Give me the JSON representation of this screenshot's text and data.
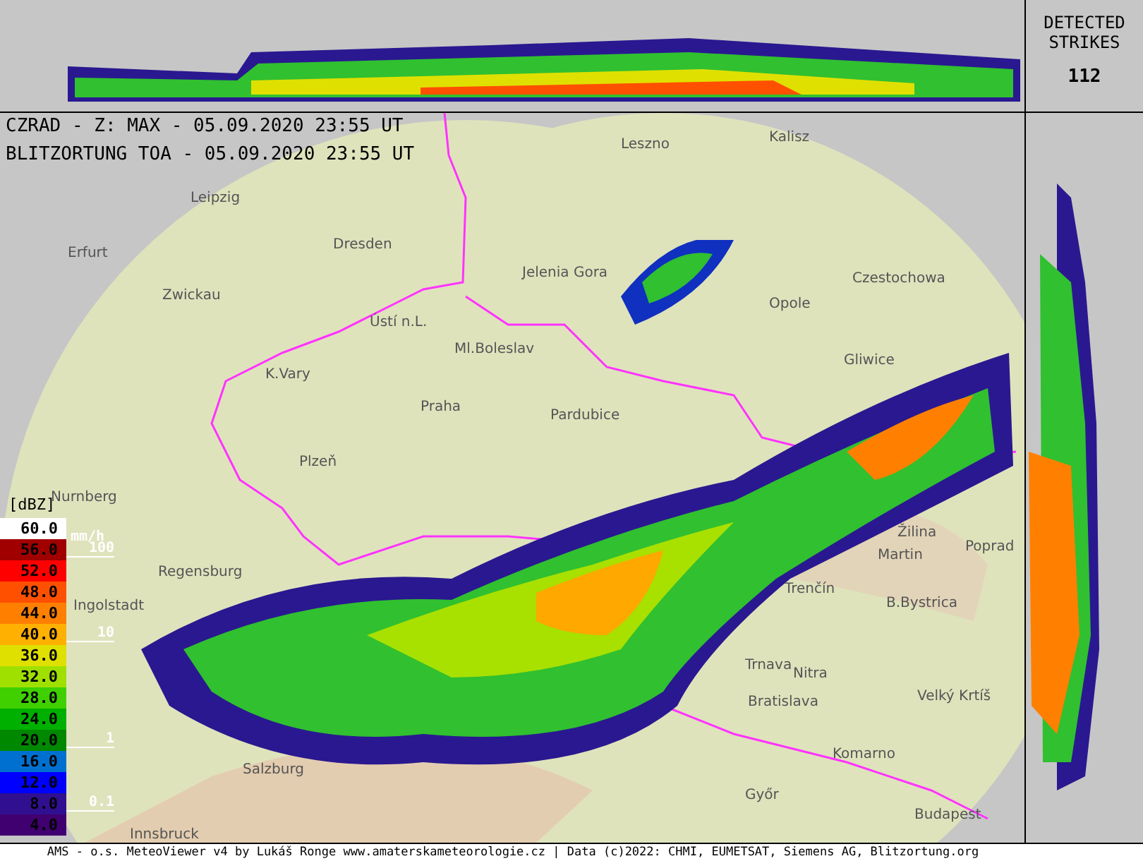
{
  "header": {
    "lines": [
      "CZRAD - Z: MAX - 05.09.2020 23:55 UT",
      "BLITZORTUNG TOA - 05.09.2020 23:55 UT"
    ]
  },
  "strikes": {
    "title_lines": [
      "DETECTED",
      "STRIKES"
    ],
    "count": "112"
  },
  "legend": {
    "unit": "[dBZ]",
    "rows": [
      {
        "label": "60.0",
        "color": "#ffffff"
      },
      {
        "label": "56.0",
        "color": "#a00000"
      },
      {
        "label": "52.0",
        "color": "#ff0000"
      },
      {
        "label": "48.0",
        "color": "#ff5000"
      },
      {
        "label": "44.0",
        "color": "#ff8000"
      },
      {
        "label": "40.0",
        "color": "#ffb000"
      },
      {
        "label": "36.0",
        "color": "#e0e000"
      },
      {
        "label": "32.0",
        "color": "#a0e000"
      },
      {
        "label": "28.0",
        "color": "#40d000"
      },
      {
        "label": "24.0",
        "color": "#00b000"
      },
      {
        "label": "20.0",
        "color": "#008800"
      },
      {
        "label": "16.0",
        "color": "#0070d0"
      },
      {
        "label": "12.0",
        "color": "#0000ff"
      },
      {
        "label": "8.0",
        "color": "#301090"
      },
      {
        "label": "4.0",
        "color": "#400070"
      }
    ],
    "rain_unit": "mm/h",
    "rain_marks": [
      "100",
      "10",
      "1",
      "0.1"
    ]
  },
  "cities": [
    {
      "name": "Leszno"
    },
    {
      "name": "Kalisz"
    },
    {
      "name": "Leipzig"
    },
    {
      "name": "Erfurt"
    },
    {
      "name": "Dresden"
    },
    {
      "name": "Jelenia Gora"
    },
    {
      "name": "Opole"
    },
    {
      "name": "Czestochowa"
    },
    {
      "name": "Zwickau"
    },
    {
      "name": "Ústí n.L."
    },
    {
      "name": "Ml.Boleslav"
    },
    {
      "name": "K.Vary"
    },
    {
      "name": "Praha"
    },
    {
      "name": "Pardubice"
    },
    {
      "name": "Gliwice"
    },
    {
      "name": "Plzeň"
    },
    {
      "name": "Nurnberg"
    },
    {
      "name": "Regensburg"
    },
    {
      "name": "Ingolstadt"
    },
    {
      "name": "Žilina"
    },
    {
      "name": "Martin"
    },
    {
      "name": "Poprad"
    },
    {
      "name": "Trenčín"
    },
    {
      "name": "B.Bystrica"
    },
    {
      "name": "Trnava"
    },
    {
      "name": "Nitra"
    },
    {
      "name": "Bratislava"
    },
    {
      "name": "Velký Krtíš"
    },
    {
      "name": "Salzburg"
    },
    {
      "name": "Komarno"
    },
    {
      "name": "Győr"
    },
    {
      "name": "Budapest"
    },
    {
      "name": "Innsbruck"
    }
  ],
  "footer": "AMS - o.s. MeteoViewer v4 by Lukáš Ronge www.amaterskameteorologie.cz | Data (c)2022: CHMI, EUMETSAT, Siemens AG, Blitzortung.org"
}
